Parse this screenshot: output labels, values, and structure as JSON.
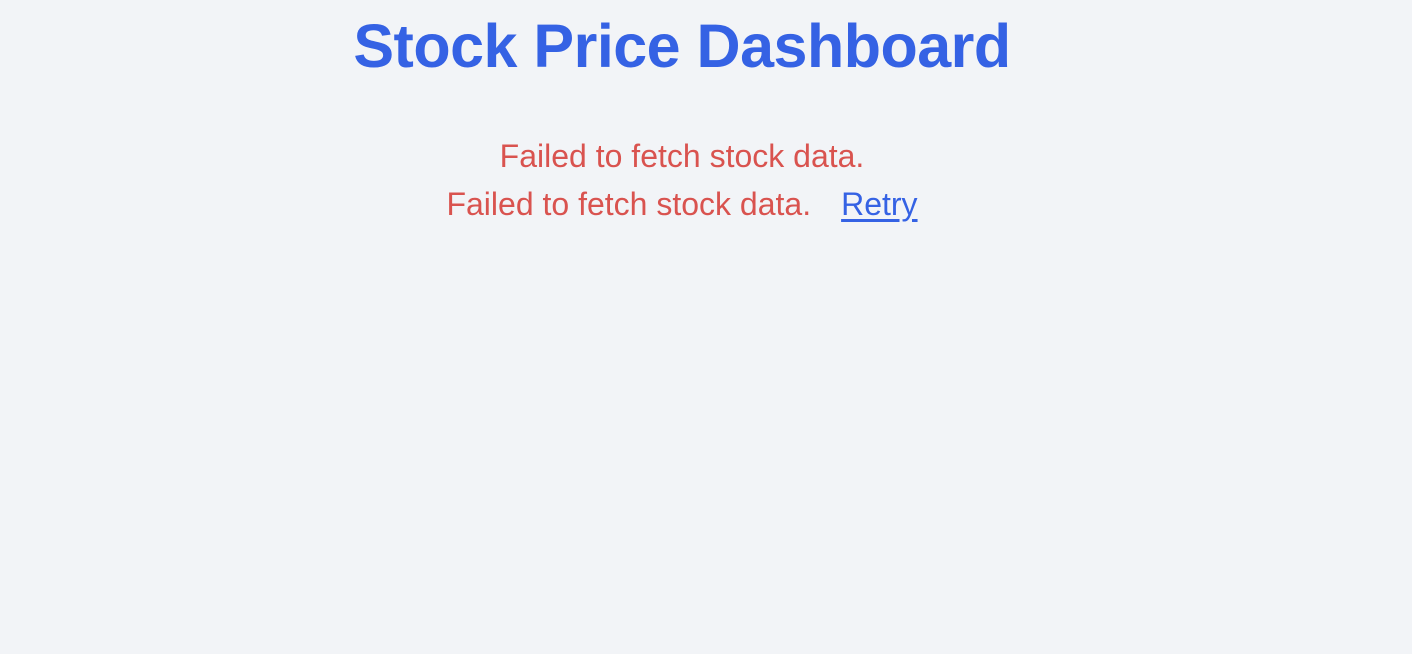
{
  "page": {
    "title": "Stock Price Dashboard"
  },
  "errors": {
    "primary_message": "Failed to fetch stock data.",
    "secondary_message": "Failed to fetch stock data.",
    "retry_label": "Retry"
  },
  "colors": {
    "title": "#3562e4",
    "error": "#d9534f",
    "link": "#3562e4",
    "background": "#f2f4f7"
  }
}
